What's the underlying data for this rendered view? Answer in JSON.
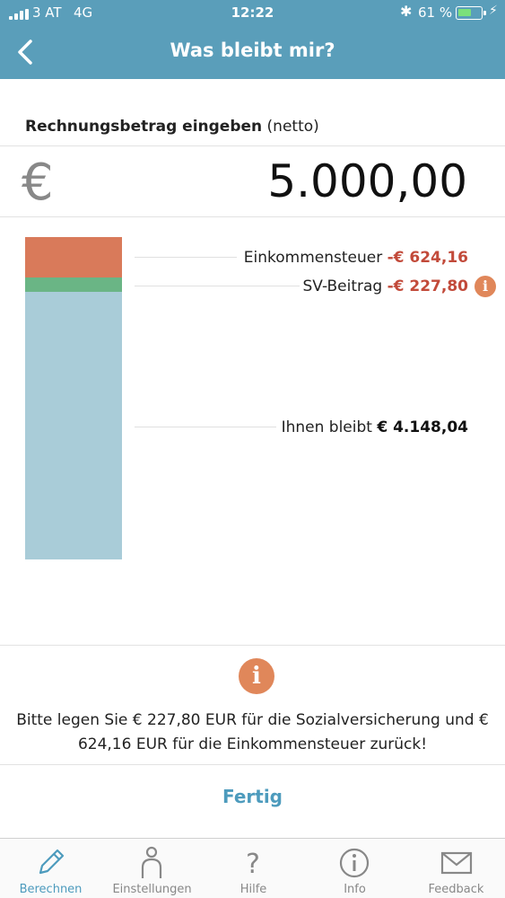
{
  "status": {
    "carrier": "3 AT",
    "network": "4G",
    "time": "12:22",
    "battery_pct": "61 %",
    "battery_level": 0.61
  },
  "nav": {
    "title": "Was bleibt mir?",
    "back_icon": "chevron-left-icon"
  },
  "input": {
    "label_bold": "Rechnungsbetrag eingeben",
    "label_suffix": "(netto)",
    "currency_symbol": "€",
    "amount": "5.000,00"
  },
  "breakdown": {
    "total": 5000.0,
    "items": [
      {
        "label": "Einkommensteuer",
        "value_text": "-€ 624,16",
        "value": 624.16,
        "color": "#d97a5a"
      },
      {
        "label": "SV-Beitrag",
        "value_text": "-€ 227,80",
        "value": 227.8,
        "color": "#6ab585",
        "info_icon": "info-icon"
      },
      {
        "label": "Ihnen bleibt",
        "value_text": "€ 4.148,04",
        "value": 4148.04,
        "color": "#a9ccd8"
      }
    ]
  },
  "hint": {
    "icon": "info-icon",
    "text": "Bitte legen Sie € 227,80 EUR für die Sozialversicherung und € 624,16 EUR für die Einkommensteuer zurück!"
  },
  "done_label": "Fertig",
  "tabs": [
    {
      "label": "Berechnen",
      "icon": "pencil-icon",
      "active": true
    },
    {
      "label": "Einstellungen",
      "icon": "person-icon",
      "active": false
    },
    {
      "label": "Hilfe",
      "icon": "question-icon",
      "active": false
    },
    {
      "label": "Info",
      "icon": "info-icon",
      "active": false
    },
    {
      "label": "Feedback",
      "icon": "envelope-icon",
      "active": false
    }
  ],
  "colors": {
    "header": "#5a9eba",
    "accent": "#4d9bbd",
    "negative": "#c24a3a",
    "info": "#e0875a"
  }
}
